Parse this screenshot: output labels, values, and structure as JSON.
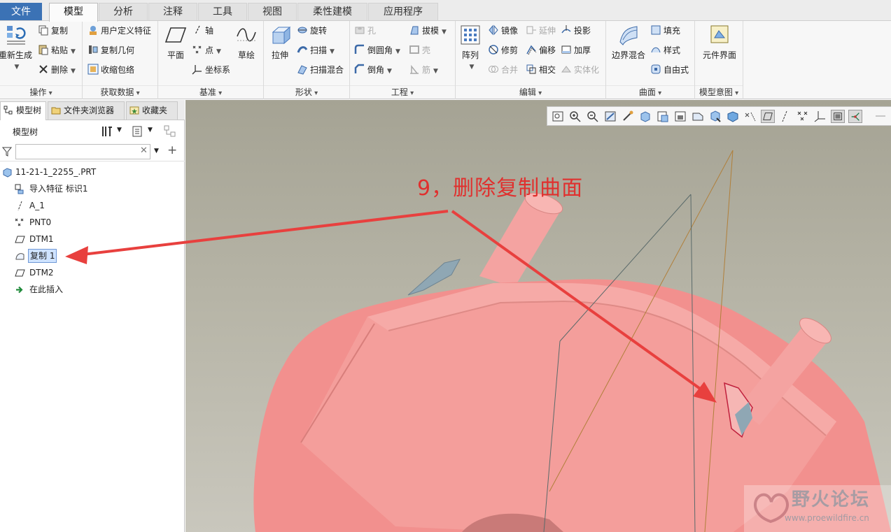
{
  "menu_tabs": [
    {
      "label": "文件"
    },
    {
      "label": "模型"
    },
    {
      "label": "分析"
    },
    {
      "label": "注释"
    },
    {
      "label": "工具"
    },
    {
      "label": "视图"
    },
    {
      "label": "柔性建模"
    },
    {
      "label": "应用程序"
    }
  ],
  "ribbon": {
    "ops": {
      "label": "操作",
      "regen": "重新生成",
      "copy": "复制",
      "paste": "粘贴",
      "delete": "删除"
    },
    "getdata": {
      "label": "获取数据",
      "udf": "用户定义特征",
      "copygeom": "复制几何",
      "shrinkwrap": "收缩包络"
    },
    "datum": {
      "label": "基准",
      "plane": "平面",
      "axis": "轴",
      "point": "点",
      "csys": "坐标系",
      "sketch": "草绘"
    },
    "shapes": {
      "label": "形状",
      "extrude": "拉伸",
      "revolve": "旋转",
      "sweep": "扫描",
      "swept_blend": "扫描混合"
    },
    "eng": {
      "label": "工程",
      "hole": "孔",
      "round": "倒圆角",
      "chamfer": "倒角",
      "draft": "拔模",
      "shell": "壳",
      "rib": "筋"
    },
    "edit": {
      "label": "编辑",
      "pattern": "阵列",
      "mirror": "镜像",
      "extend": "延伸",
      "project": "投影",
      "trim": "修剪",
      "offset": "偏移",
      "thicken": "加厚",
      "merge": "合并",
      "intersect": "相交",
      "solidify": "实体化"
    },
    "surf": {
      "label": "曲面",
      "boundary": "边界混合",
      "fill": "填充",
      "style": "样式",
      "freestyle": "自由式"
    },
    "intent": {
      "label": "模型意图",
      "component_if": "元件界面"
    }
  },
  "left_panel": {
    "tabs": [
      {
        "label": "模型树"
      },
      {
        "label": "文件夹浏览器"
      },
      {
        "label": "收藏夹"
      }
    ],
    "tree_title": "模型树",
    "search_placeholder": "",
    "items": [
      {
        "label": "11-21-1_2255_.PRT",
        "icon": "part-icon"
      },
      {
        "label": "导入特征 标识1",
        "icon": "import-feature-icon"
      },
      {
        "label": "A_1",
        "icon": "datum-axis-icon"
      },
      {
        "label": "PNT0",
        "icon": "datum-point-icon"
      },
      {
        "label": "DTM1",
        "icon": "datum-plane-icon"
      },
      {
        "label": "复制 1",
        "icon": "copy-surface-icon",
        "selected": true
      },
      {
        "label": "DTM2",
        "icon": "datum-plane-icon"
      },
      {
        "label": "在此插入",
        "icon": "insert-here-arrow-icon"
      }
    ]
  },
  "viewport": {
    "annotation": "9，删除复制曲面",
    "watermark": {
      "name": "野火论坛",
      "url": "www.proewildfire.cn"
    }
  },
  "colors": {
    "file_tab": "#3b72b5",
    "annotation": "#e0302e",
    "model": "#f29a98",
    "selection": "#cfe3ff"
  }
}
